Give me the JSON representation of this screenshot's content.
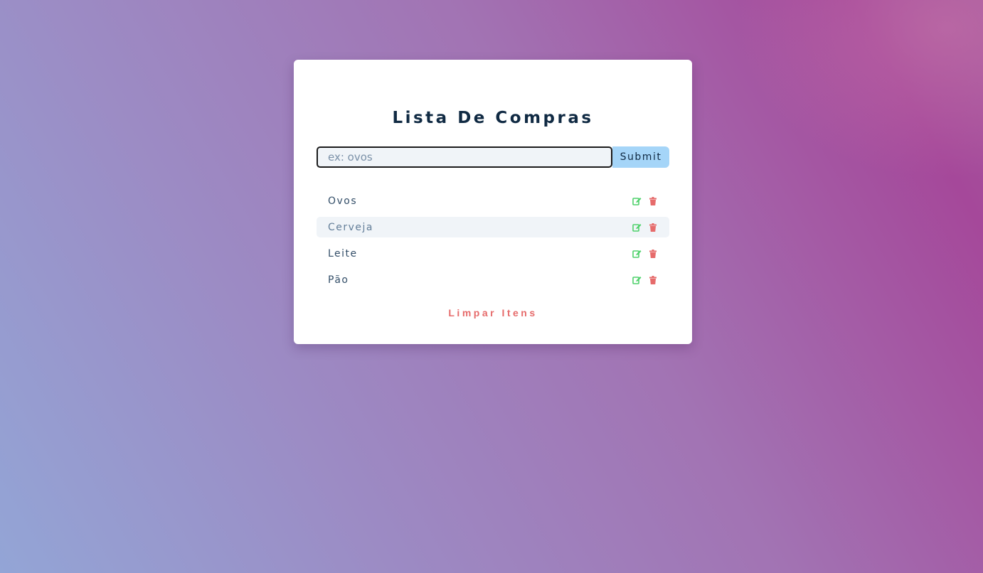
{
  "app": {
    "title": "Lista De Compras"
  },
  "form": {
    "input_placeholder": "ex: ovos",
    "input_value": "",
    "submit_label": "Submit"
  },
  "items": [
    {
      "name": "Ovos",
      "edit_icon": "edit-icon",
      "delete_icon": "trash-icon"
    },
    {
      "name": "Cerveja",
      "edit_icon": "edit-icon",
      "delete_icon": "trash-icon"
    },
    {
      "name": "Leite",
      "edit_icon": "edit-icon",
      "delete_icon": "trash-icon"
    },
    {
      "name": "Pão",
      "edit_icon": "edit-icon",
      "delete_icon": "trash-icon"
    }
  ],
  "footer": {
    "clear_label": "Limpar Itens"
  },
  "colors": {
    "edit": "#4fd16b",
    "delete": "#e66b6b",
    "title": "#102a43",
    "submit_bg": "#a5d5f8",
    "hover_row": "#f0f4f8"
  }
}
